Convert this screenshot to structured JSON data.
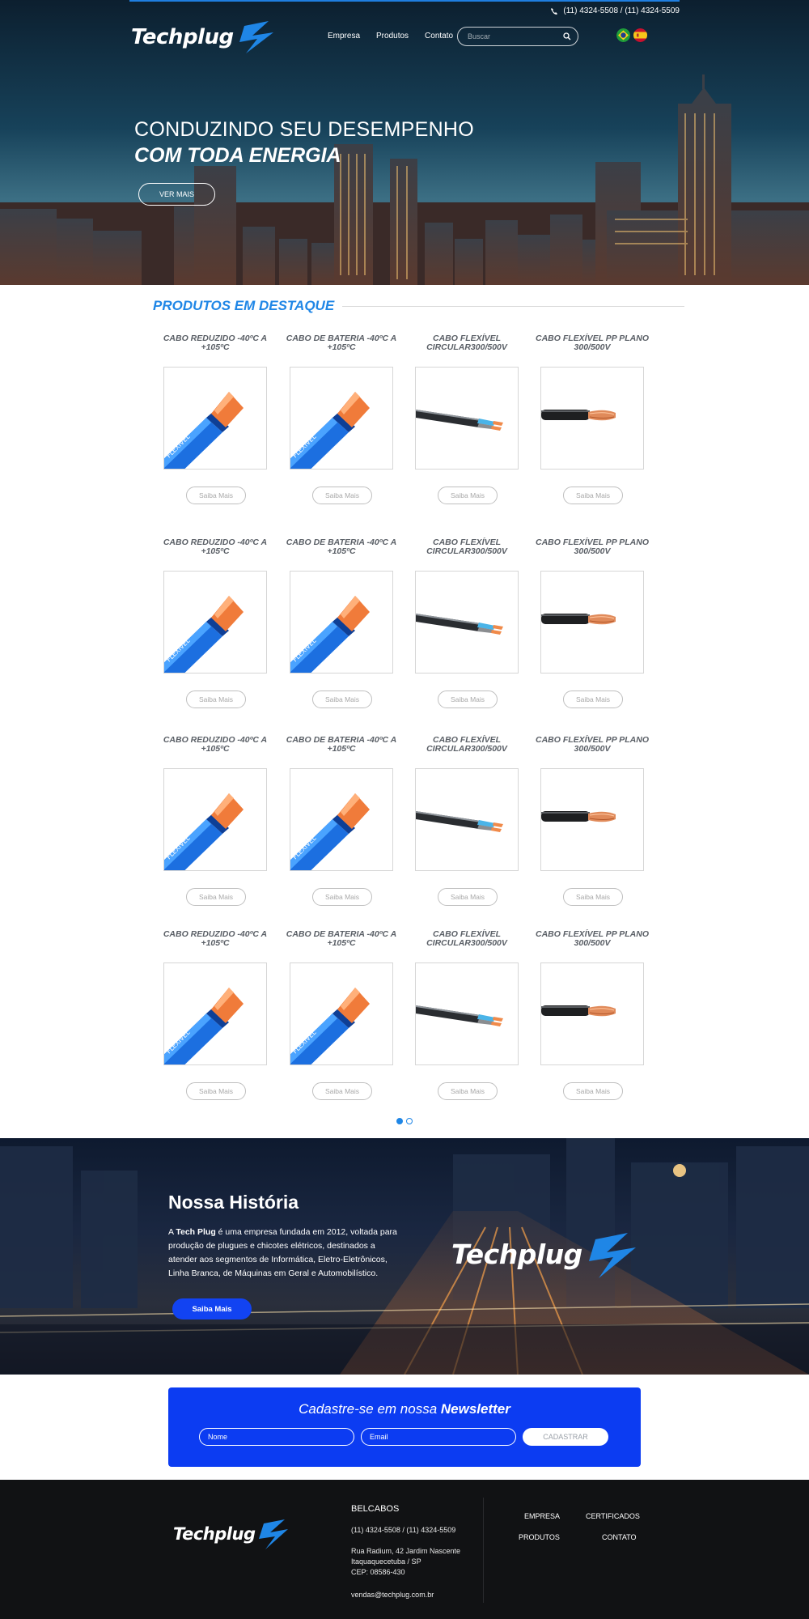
{
  "header": {
    "brand": "Techplug",
    "phone": "(11) 4324-5508 / (11) 4324-5509",
    "nav": [
      {
        "label": "Empresa"
      },
      {
        "label": "Produtos"
      },
      {
        "label": "Contato"
      }
    ],
    "search_placeholder": "Buscar",
    "icons": {
      "phone": "phone-icon",
      "search": "search-icon",
      "flags": [
        "brazil-flag-icon",
        "spain-flag-icon"
      ]
    }
  },
  "hero": {
    "title_line1": "CONDUZINDO SEU DESEMPENHO",
    "title_line2": "COM TODA ENERGIA",
    "cta": "VER MAIS"
  },
  "products": {
    "section_title": "PRODUTOS EM DESTAQUE",
    "more_label": "Saiba Mais",
    "items": [
      {
        "name": "CABO REDUZIDO -40ºC A +105ºC",
        "image": "blue-cable-image"
      },
      {
        "name": "CABO DE BATERIA -40ºC A +105ºC",
        "image": "blue-cable-image"
      },
      {
        "name": "CABO FLEXÍVEL CIRCULAR300/500V",
        "image": "circular-cable-image"
      },
      {
        "name": "CABO FLEXÍVEL PP PLANO 300/500V",
        "image": "black-cable-image"
      },
      {
        "name": "CABO REDUZIDO -40ºC A +105ºC",
        "image": "blue-cable-image"
      },
      {
        "name": "CABO DE BATERIA -40ºC A +105ºC",
        "image": "blue-cable-image"
      },
      {
        "name": "CABO FLEXÍVEL CIRCULAR300/500V",
        "image": "circular-cable-image"
      },
      {
        "name": "CABO FLEXÍVEL PP PLANO 300/500V",
        "image": "black-cable-image"
      },
      {
        "name": "CABO REDUZIDO -40ºC A +105ºC",
        "image": "blue-cable-image"
      },
      {
        "name": "CABO DE BATERIA -40ºC A +105ºC",
        "image": "blue-cable-image"
      },
      {
        "name": "CABO FLEXÍVEL CIRCULAR300/500V",
        "image": "circular-cable-image"
      },
      {
        "name": "CABO FLEXÍVEL PP PLANO 300/500V",
        "image": "black-cable-image"
      },
      {
        "name": "CABO REDUZIDO -40ºC A +105ºC",
        "image": "blue-cable-image"
      },
      {
        "name": "CABO DE BATERIA -40ºC A +105ºC",
        "image": "blue-cable-image"
      },
      {
        "name": "CABO FLEXÍVEL CIRCULAR300/500V",
        "image": "circular-cable-image"
      },
      {
        "name": "CABO FLEXÍVEL PP PLANO 300/500V",
        "image": "black-cable-image"
      }
    ],
    "pages": 2,
    "active_page": 1
  },
  "history": {
    "title": "Nossa História",
    "text_brand": "Tech Plug",
    "text_prefix": "A ",
    "text_body": " é uma empresa fundada em 2012, voltada para produção de plugues e chicotes elétricos, destinados a atender aos segmentos de Informática, Eletro-Eletrônicos, Linha Branca, de Máquinas em Geral e Automobilístico.",
    "button": "Saiba Mais"
  },
  "newsletter": {
    "title_prefix": "Cadastre-se em nossa ",
    "title_bold": "Newsletter",
    "name_placeholder": "Nome",
    "email_placeholder": "Email",
    "button": "CADASTRAR"
  },
  "footer": {
    "company": "BELCABOS",
    "phone": "(11) 4324-5508 / (11) 4324-5509",
    "address_line1": "Rua Radium, 42 Jardim Nascente",
    "address_line2": "Itaquaquecetuba / SP",
    "address_line3": "CEP: 08586-430",
    "email": "vendas@techplug.com.br",
    "links": [
      {
        "label": "EMPRESA"
      },
      {
        "label": "CERTIFICADOS"
      },
      {
        "label": "PRODUTOS"
      },
      {
        "label": "CONTATO"
      }
    ]
  },
  "colors": {
    "accent": "#1f86e6",
    "newsletter_bg": "#0c3cf2",
    "history_button": "#1243f2",
    "footer_bg": "#111214"
  }
}
